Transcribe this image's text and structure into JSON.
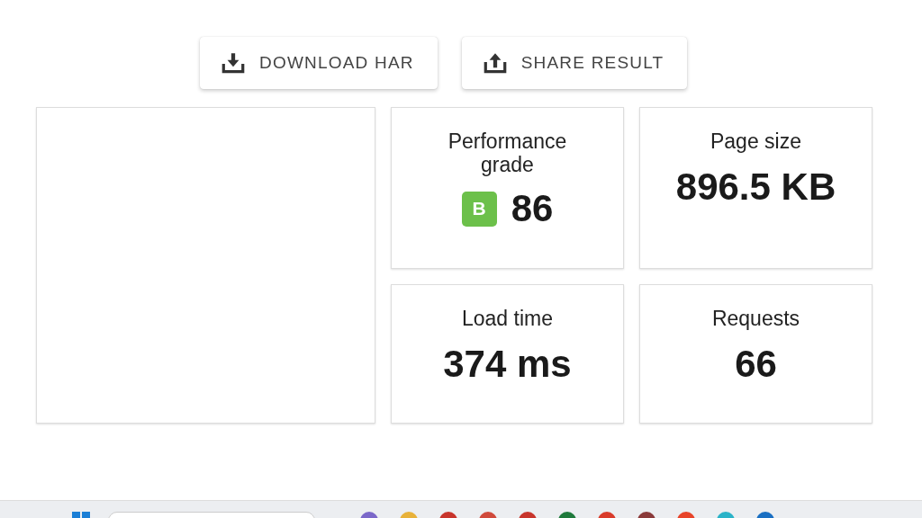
{
  "buttons": [
    {
      "label": "DOWNLOAD HAR",
      "kind": "download"
    },
    {
      "label": "SHARE RESULT",
      "kind": "share"
    }
  ],
  "metrics": [
    {
      "title": "Performance grade",
      "grade": "B",
      "value": "86"
    },
    {
      "title": "Page size",
      "value": "896.5 KB"
    },
    {
      "title": "Load time",
      "value": "374 ms"
    },
    {
      "title": "Requests",
      "value": "66"
    }
  ]
}
